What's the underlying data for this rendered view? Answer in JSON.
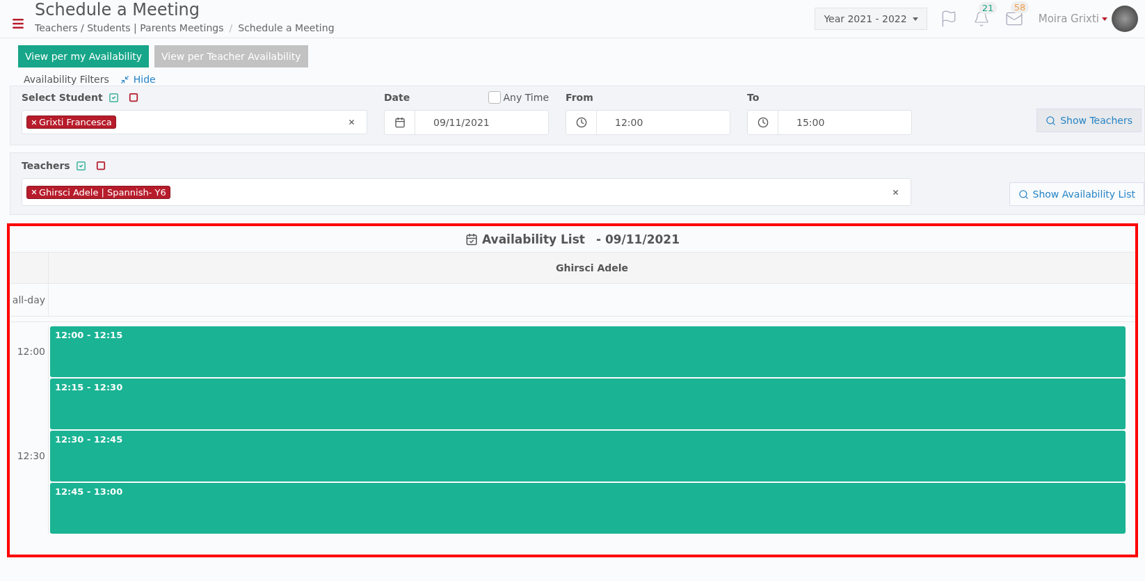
{
  "header": {
    "title": "Schedule a Meeting",
    "breadcrumb": [
      "Teachers / Students | Parents Meetings",
      "/",
      "Schedule a Meeting"
    ],
    "year": "Year 2021 - 2022",
    "notifications": "21",
    "messages": "58",
    "user": "Moira Grixti"
  },
  "view_buttons": [
    {
      "label": "View per my Availability",
      "selected": true
    },
    {
      "label": "View per Teacher Availability",
      "selected": false
    }
  ],
  "filters": {
    "legend": "Availability Filters",
    "hide": "Hide",
    "student_label": "Select Student",
    "student_tags": [
      "Grixti Francesca"
    ],
    "date_label": "Date",
    "any_time": {
      "label": "Any Time",
      "checked": false
    },
    "date": "09/11/2021",
    "from_label": "From",
    "from": "12:00",
    "to_label": "To",
    "to": "15:00",
    "show_button": "Show Teachers"
  },
  "teachers": {
    "label": "Teachers",
    "tags": [
      "Ghirsci Adele | Spannish- Y6"
    ],
    "show_button": "Show Availability List"
  },
  "calendar": {
    "title": "Availability List",
    "date": "- 09/11/2021",
    "column": "Ghirsci Adele",
    "allday": "all-day",
    "slots": [
      {
        "label": "12:00",
        "event": "12:00 - 12:15"
      },
      {
        "event": "12:15 - 12:30"
      },
      {
        "label": "12:30",
        "event": "12:30 - 12:45"
      },
      {
        "event": "12:45 - 13:00"
      }
    ]
  }
}
